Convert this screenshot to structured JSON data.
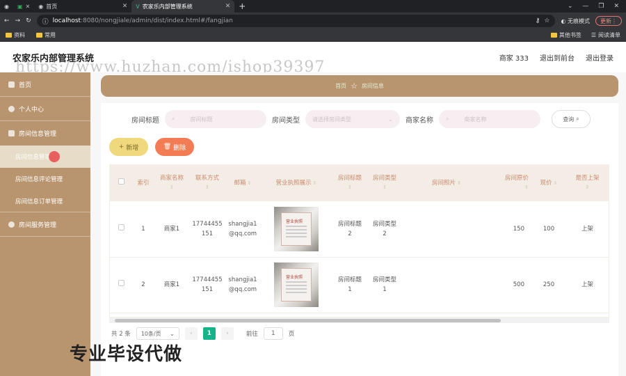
{
  "browser": {
    "tabs": [
      {
        "label": ""
      },
      {
        "label": ""
      },
      {
        "label": "首页"
      },
      {
        "label": "农家乐内部管理系统"
      }
    ],
    "url_host": "localhost",
    "url_path": ":8080/nongjiale/admin/dist/index.html#/fangjian",
    "incognito_label": "无痕模式",
    "update_label": "更新",
    "bookmarks": [
      "资料",
      "常用"
    ],
    "bookmarks_right": [
      "其他书签",
      "阅读清单"
    ]
  },
  "header": {
    "title": "农家乐内部管理系统",
    "user": "商家 333",
    "back_front": "退出到前台",
    "logout": "退出登录"
  },
  "watermark": "https://www.huzhan.com/ishop39397",
  "sidebar": {
    "items": [
      {
        "label": "首页"
      },
      {
        "label": "个人中心"
      },
      {
        "label": "房间信息管理"
      }
    ],
    "sub": [
      {
        "label": "房间信息管理"
      },
      {
        "label": "房间信息评论管理"
      },
      {
        "label": "房间信息订单管理"
      }
    ],
    "service": "房间服务管理"
  },
  "breadcrumb": {
    "home": "首页",
    "current": "房间信息"
  },
  "search": {
    "title_label": "房间标题",
    "title_placeholder": "房间标题",
    "type_label": "房间类型",
    "type_placeholder": "请选择房间类型",
    "merchant_label": "商家名称",
    "merchant_placeholder": "商家名称",
    "query_button": "查询"
  },
  "actions": {
    "add": "新增",
    "delete": "删除"
  },
  "table": {
    "headers": [
      "索引",
      "商家名称",
      "联系方式",
      "邮箱",
      "营业执照展示",
      "房间标题",
      "房间类型",
      "房间照片",
      "房间原价",
      "现价",
      "是否上架"
    ],
    "license_text": "营业执照",
    "rows": [
      {
        "index": "1",
        "merchant": "商家1",
        "phone": "17744455151",
        "email": "shangjia1@qq.com",
        "title": "房间标题2",
        "type": "房间类型2",
        "price": "150",
        "now": "100",
        "status": "上架"
      },
      {
        "index": "2",
        "merchant": "商家1",
        "phone": "17744455151",
        "email": "shangjia1@qq.com",
        "title": "房间标题1",
        "type": "房间类型1",
        "price": "500",
        "now": "250",
        "status": "上架"
      }
    ]
  },
  "pager": {
    "total": "共 2 条",
    "size": "10条/页",
    "current": "1",
    "goto_label": "前往",
    "goto_value": "1",
    "page_unit": "页"
  },
  "overlay": "专业毕设代做"
}
